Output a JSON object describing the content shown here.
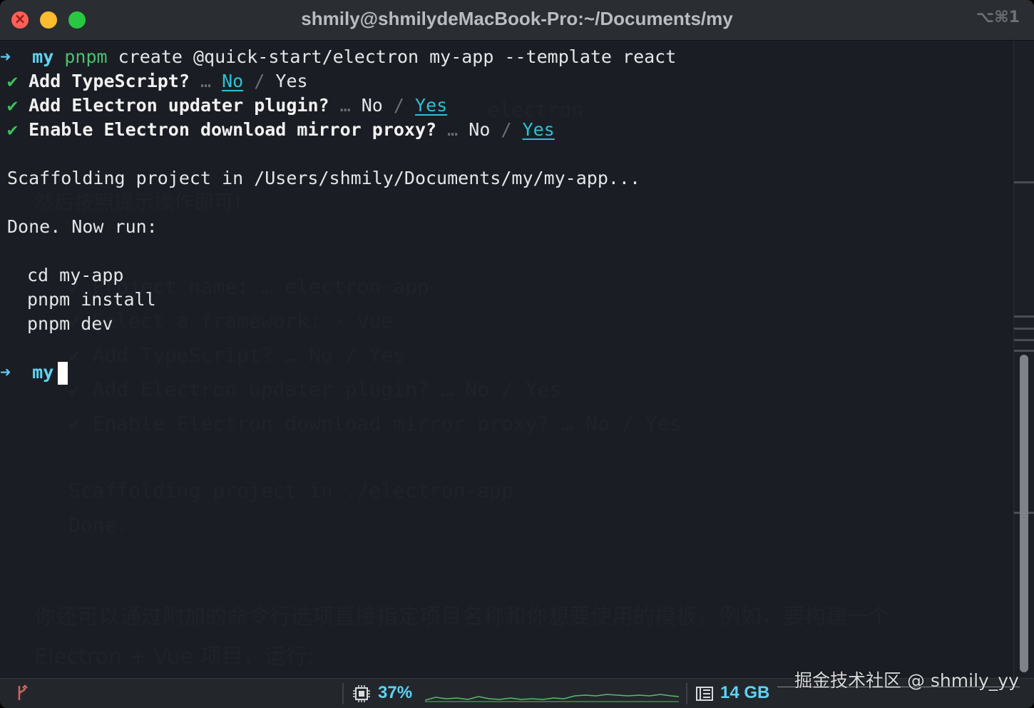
{
  "window": {
    "title": "shmily@shmilydeMacBook-Pro:~/Documents/my",
    "shortcut": "⌥⌘1"
  },
  "terminal": {
    "prompt_arrow": "➜",
    "prompt_dir": "my",
    "command_tool": "pnpm",
    "command_args": " create @quick-start/electron my-app --template react",
    "check_mark": "✔",
    "ellipsis": "…",
    "slash": "/",
    "questions": [
      {
        "text": "Add TypeScript?",
        "no": "No",
        "yes": "Yes",
        "selected": "No"
      },
      {
        "text": "Add Electron updater plugin?",
        "no": "No",
        "yes": "Yes",
        "selected": "Yes"
      },
      {
        "text": "Enable Electron download mirror proxy?",
        "no": "No",
        "yes": "Yes",
        "selected": "Yes"
      }
    ],
    "scaffolding": "Scaffolding project in /Users/shmily/Documents/my/my-app...",
    "done": "Done. Now run:",
    "next_steps": [
      "cd my-app",
      "pnpm install",
      "pnpm dev"
    ],
    "final_prompt_dir": "my"
  },
  "statusbar": {
    "cpu_percent": "37%",
    "memory": "14 GB"
  },
  "watermark": "掘金技术社区 @ shmily_yy",
  "colors": {
    "background": "#1a1e24",
    "prompt": "#5fd3f2",
    "check": "#39c45a",
    "selected_option": "#2fc0d6",
    "status_value": "#5fd3f2"
  },
  "icons": {
    "branch": "git-branch-icon",
    "cpu": "cpu-chip-icon",
    "memory": "memory-icon"
  }
}
